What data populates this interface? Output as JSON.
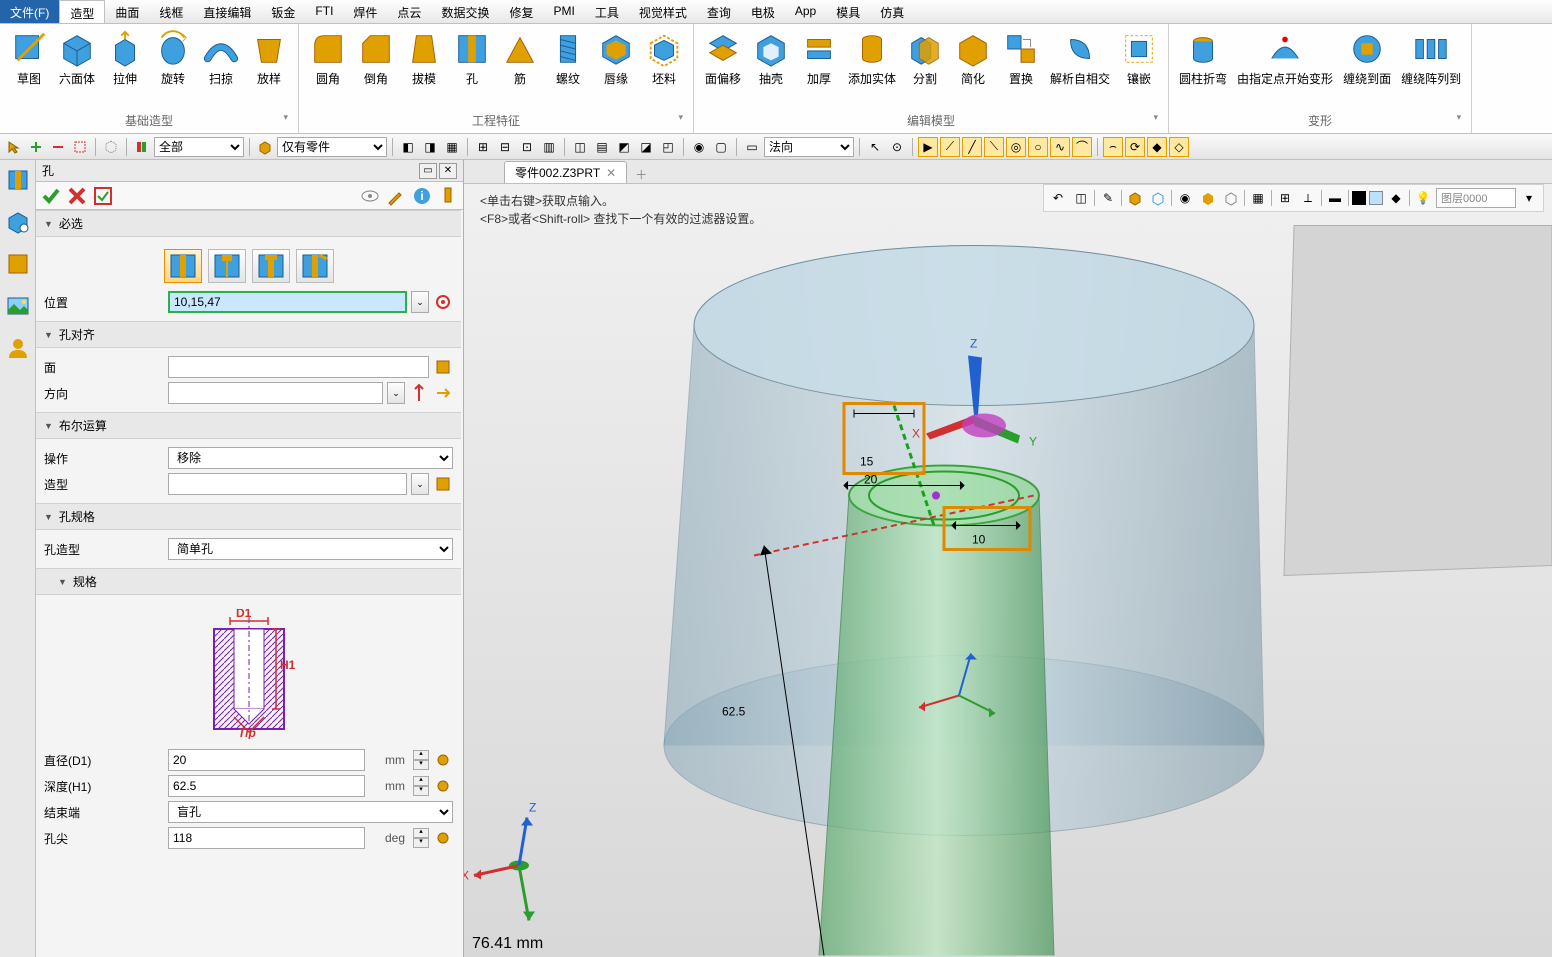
{
  "menu": {
    "file": "文件(F)",
    "items": [
      "造型",
      "曲面",
      "线框",
      "直接编辑",
      "钣金",
      "FTI",
      "焊件",
      "点云",
      "数据交换",
      "修复",
      "PMI",
      "工具",
      "视觉样式",
      "查询",
      "电极",
      "App",
      "模具",
      "仿真"
    ],
    "active": "造型"
  },
  "ribbon": {
    "groups": [
      {
        "label": "基础造型",
        "buttons": [
          "草图",
          "六面体",
          "拉伸",
          "旋转",
          "扫掠",
          "放样"
        ]
      },
      {
        "label": "工程特征",
        "buttons": [
          "圆角",
          "倒角",
          "拔模",
          "孔",
          "筋",
          "螺纹",
          "唇缘",
          "坯料"
        ]
      },
      {
        "label": "编辑模型",
        "buttons": [
          "面偏移",
          "抽壳",
          "加厚",
          "添加实体",
          "分割",
          "简化",
          "置换",
          "解析自相交",
          "镶嵌"
        ]
      },
      {
        "label": "变形",
        "buttons": [
          "圆柱折弯",
          "由指定点开始变形",
          "缠绕到面",
          "缠绕阵列到"
        ]
      }
    ]
  },
  "secToolbar": {
    "filter1": "全部",
    "filter2": "仅有零件",
    "orient": "法向"
  },
  "tab": {
    "name": "零件002.Z3PRT"
  },
  "panel": {
    "title": "孔",
    "sections": {
      "required": "必选",
      "align": "孔对齐",
      "bool": "布尔运算",
      "spec": "孔规格",
      "specSub": "规格"
    },
    "fields": {
      "position_label": "位置",
      "position_value": "10,15,47",
      "face_label": "面",
      "face_value": "",
      "dir_label": "方向",
      "dir_value": "",
      "op_label": "操作",
      "op_value": "移除",
      "shape_label": "造型",
      "shape_value": "",
      "holeType_label": "孔造型",
      "holeType_value": "简单孔",
      "diameter_label": "直径(D1)",
      "diameter_value": "20",
      "depth_label": "深度(H1)",
      "depth_value": "62.5",
      "end_label": "结束端",
      "end_value": "盲孔",
      "tip_label": "孔尖",
      "tip_value": "118",
      "unit_mm": "mm",
      "unit_deg": "deg"
    },
    "diagram": {
      "d1": "D1",
      "h1": "H1",
      "tip": "Tip"
    }
  },
  "viewport": {
    "hint1": "<单击右键>获取点输入。",
    "hint2": "<F8>或者<Shift-roll> 查找下一个有效的过滤器设置。",
    "layer_placeholder": "图层0000",
    "dims": {
      "d15": "15",
      "d20": "20",
      "d10": "10",
      "d625": "62.5"
    },
    "coord": "76.41   mm",
    "axes": {
      "x": "X",
      "y": "Y",
      "z": "Z"
    }
  }
}
